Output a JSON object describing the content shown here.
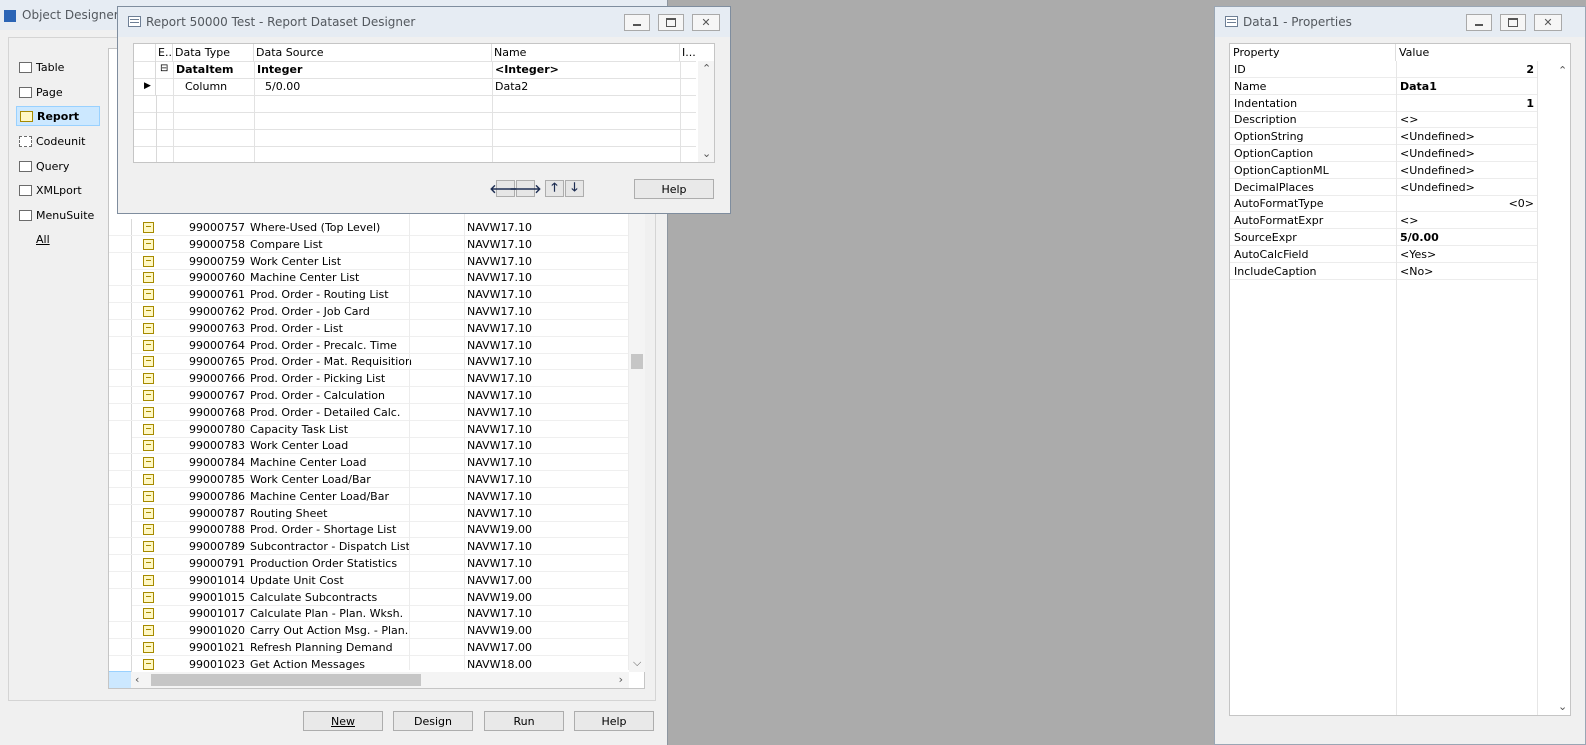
{
  "object_designer": {
    "title": "Object Designer",
    "types": [
      {
        "label": "Table",
        "icon": "table-icon"
      },
      {
        "label": "Page",
        "icon": "page-icon"
      },
      {
        "label": "Report",
        "icon": "report-icon",
        "selected": true
      },
      {
        "label": "Codeunit",
        "icon": "codeunit-icon"
      },
      {
        "label": "Query",
        "icon": "query-icon"
      },
      {
        "label": "XMLport",
        "icon": "xmlport-icon"
      },
      {
        "label": "MenuSuite",
        "icon": "menusuite-icon"
      },
      {
        "label": "All",
        "icon": ""
      }
    ],
    "rows": [
      {
        "id": "99000757",
        "name": "Where-Used (Top Level)",
        "version": "NAVW17.10"
      },
      {
        "id": "99000758",
        "name": "Compare List",
        "version": "NAVW17.10"
      },
      {
        "id": "99000759",
        "name": "Work Center List",
        "version": "NAVW17.10"
      },
      {
        "id": "99000760",
        "name": "Machine Center List",
        "version": "NAVW17.10"
      },
      {
        "id": "99000761",
        "name": "Prod. Order - Routing List",
        "version": "NAVW17.10"
      },
      {
        "id": "99000762",
        "name": "Prod. Order - Job Card",
        "version": "NAVW17.10"
      },
      {
        "id": "99000763",
        "name": "Prod. Order - List",
        "version": "NAVW17.10"
      },
      {
        "id": "99000764",
        "name": "Prod. Order - Precalc. Time",
        "version": "NAVW17.10"
      },
      {
        "id": "99000765",
        "name": "Prod. Order - Mat. Requisition",
        "version": "NAVW17.10"
      },
      {
        "id": "99000766",
        "name": "Prod. Order - Picking List",
        "version": "NAVW17.10"
      },
      {
        "id": "99000767",
        "name": "Prod. Order - Calculation",
        "version": "NAVW17.10"
      },
      {
        "id": "99000768",
        "name": "Prod. Order - Detailed Calc.",
        "version": "NAVW17.10"
      },
      {
        "id": "99000780",
        "name": "Capacity Task List",
        "version": "NAVW17.10"
      },
      {
        "id": "99000783",
        "name": "Work Center Load",
        "version": "NAVW17.10"
      },
      {
        "id": "99000784",
        "name": "Machine Center Load",
        "version": "NAVW17.10"
      },
      {
        "id": "99000785",
        "name": "Work Center Load/Bar",
        "version": "NAVW17.10"
      },
      {
        "id": "99000786",
        "name": "Machine Center Load/Bar",
        "version": "NAVW17.10"
      },
      {
        "id": "99000787",
        "name": "Routing Sheet",
        "version": "NAVW17.10"
      },
      {
        "id": "99000788",
        "name": "Prod. Order - Shortage List",
        "version": "NAVW19.00"
      },
      {
        "id": "99000789",
        "name": "Subcontractor - Dispatch List",
        "version": "NAVW17.10"
      },
      {
        "id": "99000791",
        "name": "Production Order Statistics",
        "version": "NAVW17.10"
      },
      {
        "id": "99001014",
        "name": "Update Unit Cost",
        "version": "NAVW17.00"
      },
      {
        "id": "99001015",
        "name": "Calculate Subcontracts",
        "version": "NAVW19.00"
      },
      {
        "id": "99001017",
        "name": "Calculate Plan - Plan. Wksh.",
        "version": "NAVW17.10"
      },
      {
        "id": "99001020",
        "name": "Carry Out Action Msg. - Plan.",
        "version": "NAVW19.00"
      },
      {
        "id": "99001021",
        "name": "Refresh Planning Demand",
        "version": "NAVW17.00"
      },
      {
        "id": "99001023",
        "name": "Get Action Messages",
        "version": "NAVW18.00"
      }
    ],
    "buttons": {
      "new": "New",
      "design": "Design",
      "run": "Run",
      "help": "Help"
    }
  },
  "dataset_designer": {
    "title": "Report 50000 Test - Report Dataset Designer",
    "headers": {
      "e": "E..",
      "data_type": "Data Type",
      "data_source": "Data Source",
      "name": "Name",
      "i": "I..."
    },
    "rows": [
      {
        "data_type": "DataItem",
        "data_source": "Integer",
        "name": "<Integer>"
      },
      {
        "data_type": "Column",
        "data_source": "5/0.00",
        "name": "Data2"
      }
    ],
    "help": "Help"
  },
  "properties": {
    "title": "Data1 - Properties",
    "headers": {
      "property": "Property",
      "value": "Value"
    },
    "rows": [
      {
        "name": "ID",
        "value": "2"
      },
      {
        "name": "Name",
        "value": "Data1"
      },
      {
        "name": "Indentation",
        "value": "1"
      },
      {
        "name": "Description",
        "value": "<>"
      },
      {
        "name": "OptionString",
        "value": "<Undefined>"
      },
      {
        "name": "OptionCaption",
        "value": "<Undefined>"
      },
      {
        "name": "OptionCaptionML",
        "value": "<Undefined>"
      },
      {
        "name": "DecimalPlaces",
        "value": "<Undefined>"
      },
      {
        "name": "AutoFormatType",
        "value": "<0>"
      },
      {
        "name": "AutoFormatExpr",
        "value": "<>"
      },
      {
        "name": "SourceExpr",
        "value": "5/0.00"
      },
      {
        "name": "AutoCalcField",
        "value": "<Yes>"
      },
      {
        "name": "IncludeCaption",
        "value": "<No>"
      }
    ]
  }
}
